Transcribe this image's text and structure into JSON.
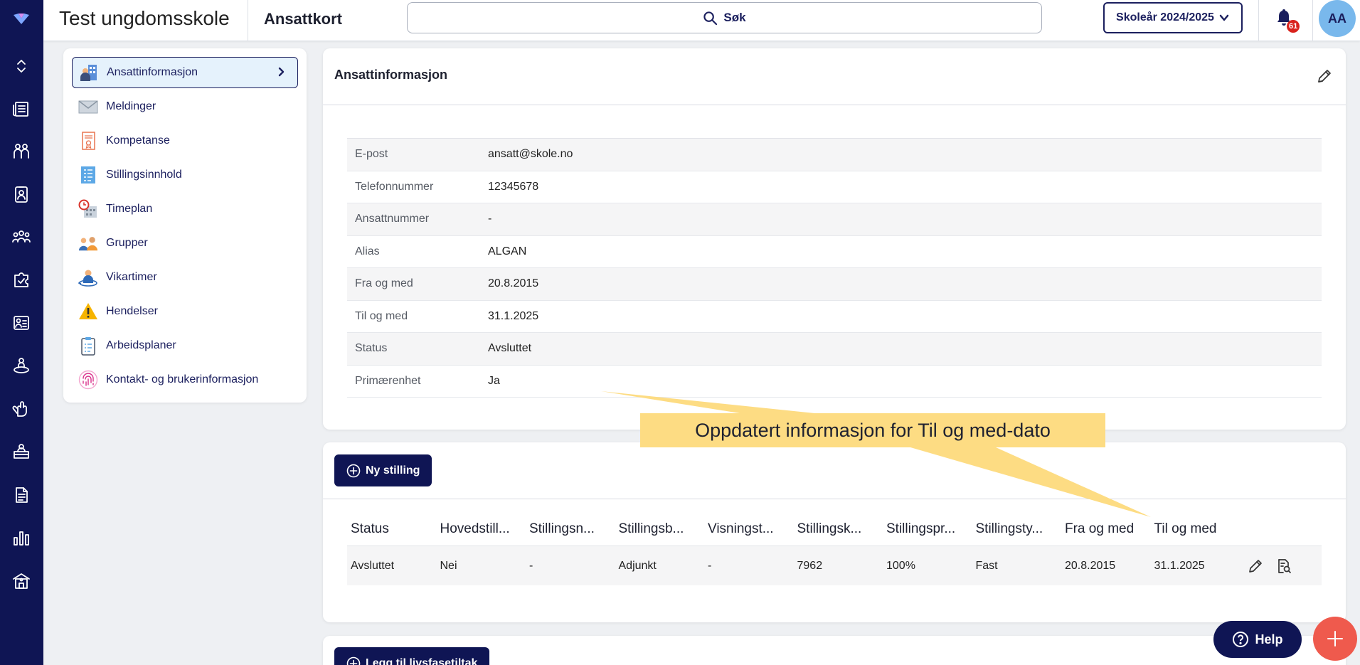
{
  "header": {
    "school_name": "Test ungdomsskole",
    "page_title": "Ansattkort",
    "search_label": "Søk",
    "school_year": "Skoleår 2024/2025",
    "notification_count": "61",
    "avatar_initials": "AA"
  },
  "rail": {
    "icons": [
      "logo-icon",
      "expand-collapse-icon",
      "news-icon",
      "students-icon",
      "badge-icon",
      "groups-icon",
      "puzzle-icon",
      "dashboard-icon",
      "person-ring-icon",
      "hand-icon",
      "desk-icon",
      "document-icon",
      "bar-chart-icon",
      "school-icon"
    ]
  },
  "menu": {
    "items": [
      {
        "label": "Ansattinformasjon",
        "icon": "employee-info-icon",
        "active": true
      },
      {
        "label": "Meldinger",
        "icon": "envelope-icon"
      },
      {
        "label": "Kompetanse",
        "icon": "certificate-icon"
      },
      {
        "label": "Stillingsinnhold",
        "icon": "position-content-icon"
      },
      {
        "label": "Timeplan",
        "icon": "schedule-icon"
      },
      {
        "label": "Grupper",
        "icon": "group-people-icon"
      },
      {
        "label": "Vikartimer",
        "icon": "substitute-icon"
      },
      {
        "label": "Hendelser",
        "icon": "warning-icon"
      },
      {
        "label": "Arbeidsplaner",
        "icon": "clipboard-icon"
      },
      {
        "label": "Kontakt- og brukerinformasjon",
        "icon": "fingerprint-icon"
      }
    ]
  },
  "info": {
    "title": "Ansattinformasjon",
    "rows": [
      {
        "label": "E-post",
        "value": "ansatt@skole.no"
      },
      {
        "label": "Telefonnummer",
        "value": "12345678"
      },
      {
        "label": "Ansattnummer",
        "value": "-"
      },
      {
        "label": "Alias",
        "value": "ALGAN"
      },
      {
        "label": "Fra og med",
        "value": "20.8.2015"
      },
      {
        "label": "Til og med",
        "value": "31.1.2025"
      },
      {
        "label": "Status",
        "value": "Avsluttet"
      },
      {
        "label": "Primærenhet",
        "value": "Ja"
      }
    ]
  },
  "callout": {
    "text": "Oppdatert informasjon for Til og med-dato",
    "color": "#fddc83"
  },
  "positions": {
    "new_button": "Ny stilling",
    "columns": [
      "Status",
      "Hovedstill...",
      "Stillingsn...",
      "Stillingsb...",
      "Visningst...",
      "Stillingsk...",
      "Stillingspr...",
      "Stillingsty...",
      "Fra og med",
      "Til og med"
    ],
    "rows": [
      [
        "Avsluttet",
        "Nei",
        "-",
        "Adjunkt",
        "-",
        "7962",
        "100%",
        "Fast",
        "20.8.2015",
        "31.1.2025"
      ]
    ]
  },
  "life_phase": {
    "button": "Legg til livsfasetiltak"
  },
  "help": {
    "label": "Help"
  },
  "colors": {
    "navy": "#0f1554",
    "accent_red": "#ef5a4d",
    "active_bg": "#e5f2fc"
  }
}
